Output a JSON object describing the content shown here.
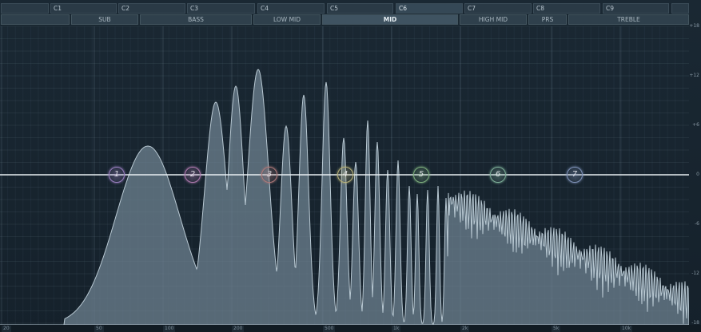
{
  "note_bar": {
    "cells": [
      "",
      "C1",
      "C2",
      "C3",
      "C4",
      "C5",
      "C6",
      "C7",
      "C8",
      "C9",
      ""
    ],
    "active": "C6"
  },
  "band_bar": {
    "bands": [
      "",
      "SUB",
      "BASS",
      "LOW MID",
      "MID",
      "HIGH MID",
      "PRS",
      "TREBLE"
    ],
    "active": "MID"
  },
  "db_scale": [
    "+18",
    "+12",
    "+6",
    "0",
    "-6",
    "-12",
    "-18"
  ],
  "freq_scale": [
    "20",
    "50",
    "100",
    "200",
    "500",
    "1k",
    "2k",
    "5k",
    "10k"
  ],
  "eq_nodes": [
    {
      "label": "1",
      "color": "#9a7fc0"
    },
    {
      "label": "2",
      "color": "#b07ab0"
    },
    {
      "label": "3",
      "color": "#b07a7a"
    },
    {
      "label": "4",
      "color": "#b8b27a"
    },
    {
      "label": "5",
      "color": "#7fb07f"
    },
    {
      "label": "6",
      "color": "#7fb09a"
    },
    {
      "label": "7",
      "color": "#7f92b8"
    }
  ],
  "colors": {
    "background": "#16222c",
    "curve_line": "#e8eef2",
    "spectrum_fill": "#6e8290",
    "spectrum_stroke": "#b8c8d2"
  }
}
